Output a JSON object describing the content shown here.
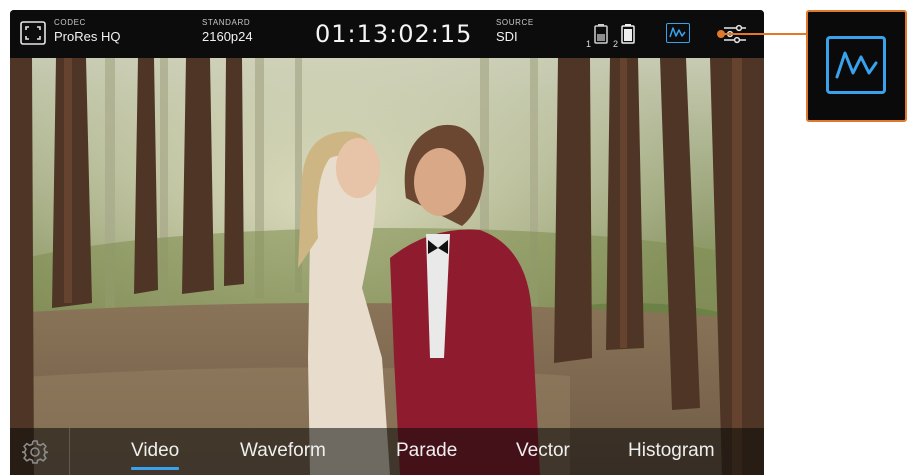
{
  "status_bar": {
    "codec": {
      "label": "CODEC",
      "value": "ProRes HQ"
    },
    "standard": {
      "label": "STANDARD",
      "value": "2160p24"
    },
    "timecode": "01:13:02:15",
    "source": {
      "label": "SOURCE",
      "value": "SDI"
    },
    "batteries": [
      {
        "slot": "1",
        "icon": "battery-icon"
      },
      {
        "slot": "2",
        "icon": "battery-icon"
      }
    ],
    "scope_button_icon": "waveform-icon",
    "settings_icon": "sliders-icon"
  },
  "tabs": [
    {
      "label": "Video",
      "active": true
    },
    {
      "label": "Waveform",
      "active": false
    },
    {
      "label": "Parade",
      "active": false
    },
    {
      "label": "Vector",
      "active": false
    },
    {
      "label": "Histogram",
      "active": false
    }
  ],
  "settings_button_icon": "gear-icon",
  "callout": {
    "icon": "waveform-icon"
  },
  "colors": {
    "accent": "#3aa2ec",
    "callout": "#e07a2a",
    "bar": "#0c0c0c"
  }
}
